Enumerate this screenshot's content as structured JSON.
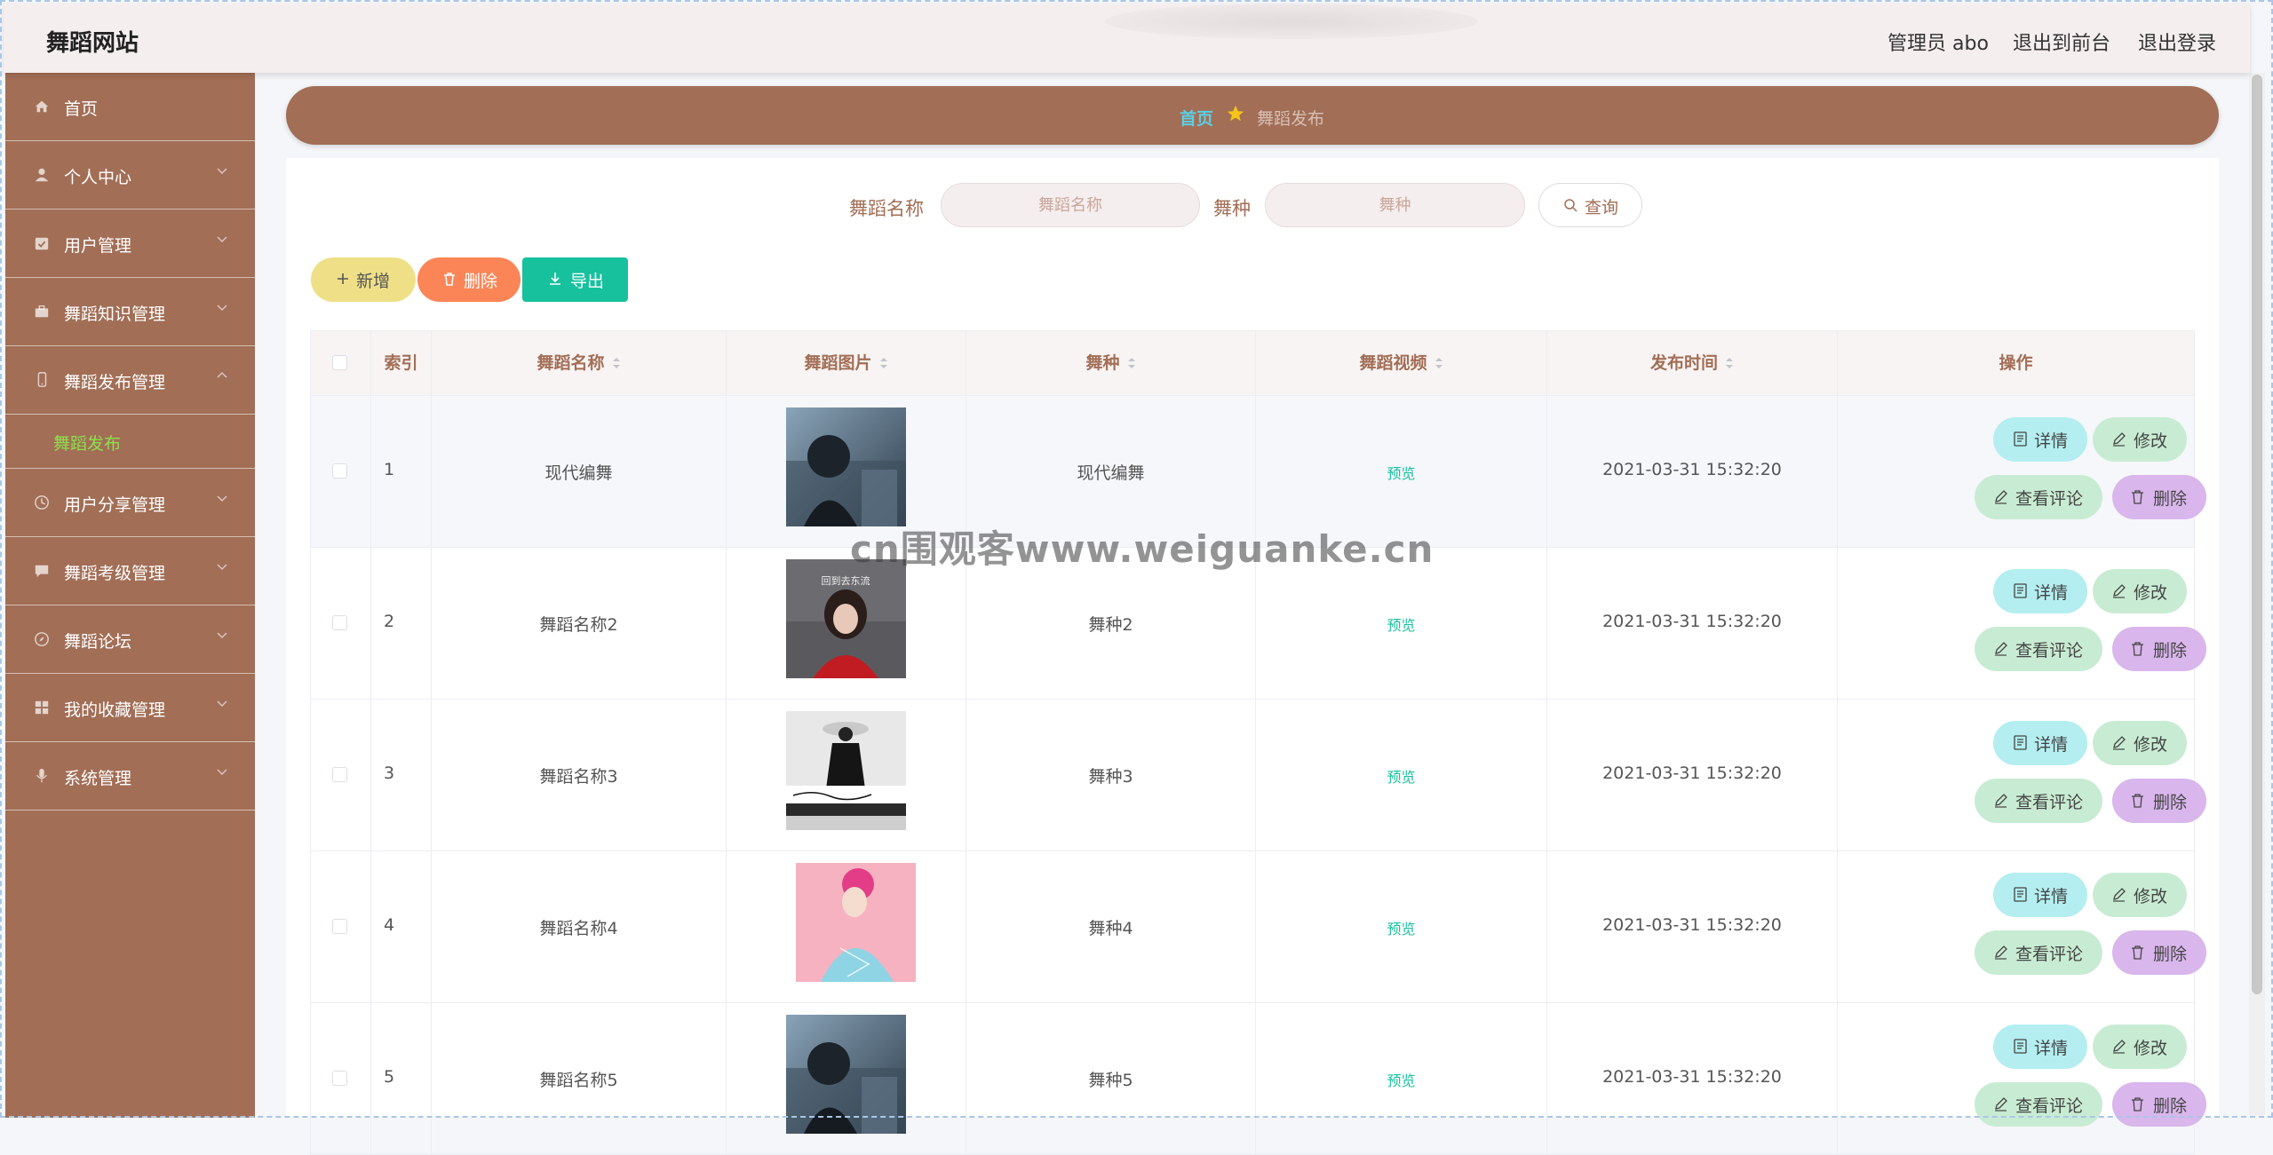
{
  "header": {
    "site_title": "舞蹈网站",
    "admin_label": "管理员 abo",
    "to_front": "退出到前台",
    "logout": "退出登录"
  },
  "sidebar": {
    "items": [
      {
        "label": "首页",
        "icon": "home-icon",
        "expandable": false
      },
      {
        "label": "个人中心",
        "icon": "user-icon",
        "expandable": true
      },
      {
        "label": "用户管理",
        "icon": "calendar-check-icon",
        "expandable": true
      },
      {
        "label": "舞蹈知识管理",
        "icon": "briefcase-icon",
        "expandable": true
      },
      {
        "label": "舞蹈发布管理",
        "icon": "mobile-icon",
        "expandable": true,
        "expanded": true
      },
      {
        "label": "用户分享管理",
        "icon": "clock-icon",
        "expandable": true
      },
      {
        "label": "舞蹈考级管理",
        "icon": "message-icon",
        "expandable": true
      },
      {
        "label": "舞蹈论坛",
        "icon": "compass-icon",
        "expandable": true
      },
      {
        "label": "我的收藏管理",
        "icon": "grid-icon",
        "expandable": true
      },
      {
        "label": "系统管理",
        "icon": "microphone-icon",
        "expandable": true
      }
    ],
    "submenu_active": "舞蹈发布"
  },
  "breadcrumb": {
    "home": "首页",
    "current": "舞蹈发布"
  },
  "search": {
    "name_label": "舞蹈名称",
    "name_placeholder": "舞蹈名称",
    "type_label": "舞种",
    "type_placeholder": "舞种",
    "query_button": "查询"
  },
  "actions": {
    "add": "新增",
    "delete": "删除",
    "export": "导出"
  },
  "table": {
    "headers": [
      "索引",
      "舞蹈名称",
      "舞蹈图片",
      "舞种",
      "舞蹈视频",
      "发布时间",
      "操作"
    ],
    "preview_label": "预览",
    "op_labels": {
      "detail": "详情",
      "edit": "修改",
      "comment": "查看评论",
      "remove": "删除"
    },
    "rows": [
      {
        "index": "1",
        "name": "现代编舞",
        "type": "现代编舞",
        "time": "2021-03-31 15:32:20",
        "image": "portrait-man-dark"
      },
      {
        "index": "2",
        "name": "舞蹈名称2",
        "type": "舞种2",
        "time": "2021-03-31 15:32:20",
        "image": "album-red-woman"
      },
      {
        "index": "3",
        "name": "舞蹈名称3",
        "type": "舞种3",
        "time": "2021-03-31 15:32:20",
        "image": "album-black-coat"
      },
      {
        "index": "4",
        "name": "舞蹈名称4",
        "type": "舞种4",
        "time": "2021-03-31 15:32:20",
        "image": "album-pink-hair"
      },
      {
        "index": "5",
        "name": "舞蹈名称5",
        "type": "舞种5",
        "time": "2021-03-31 15:32:20",
        "image": "portrait-man-dark"
      }
    ]
  },
  "colors": {
    "sidebar_bg": "#a26e56",
    "header_bg": "#f5eeee",
    "add_btn": "#efe088",
    "delete_btn": "#fb8557",
    "export_btn": "#17c19e",
    "detail_btn": "#b4eef0",
    "edit_btn": "#c8ecd3",
    "remove_btn": "#d9b6ec",
    "active_submenu": "#8de04d"
  },
  "watermark": "cn围观客www.weiguanke.cn"
}
